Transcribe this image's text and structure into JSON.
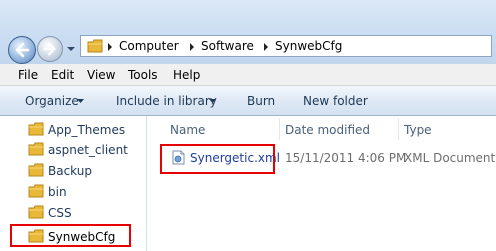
{
  "address_bar": {
    "crumbs": [
      "Computer",
      "Software",
      "SynwebCfg"
    ]
  },
  "menu": {
    "items": [
      "File",
      "Edit",
      "View",
      "Tools",
      "Help"
    ]
  },
  "command_bar": {
    "organize": "Organize",
    "include_in_library": "Include in library",
    "burn": "Burn",
    "new_folder": "New folder"
  },
  "nav_pane": {
    "items": [
      "App_Themes",
      "aspnet_client",
      "Backup",
      "bin",
      "CSS",
      "SynwebCfg"
    ],
    "highlighted": "SynwebCfg"
  },
  "file_list": {
    "columns": {
      "name": "Name",
      "date_modified": "Date modified",
      "type": "Type"
    },
    "rows": [
      {
        "name": "Synergetic.xml",
        "date_modified": "15/11/2011 4:06 PM",
        "type": "XML Document"
      }
    ]
  },
  "colors": {
    "highlight_box": "#e60000",
    "link_text": "#1e3e9b",
    "folder": "#e8b838"
  },
  "icons": {
    "back": "back-arrow-icon",
    "forward": "forward-arrow-icon",
    "folder": "folder-icon",
    "file": "xml-file-icon"
  }
}
